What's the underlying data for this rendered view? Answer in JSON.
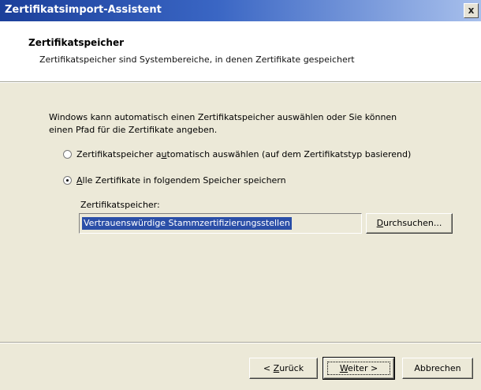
{
  "window": {
    "title": "Zertifikatsimport-Assistent",
    "close_label": "x"
  },
  "header": {
    "title": "Zertifikatspeicher",
    "subtitle": "Zertifikatspeicher sind Systembereiche, in denen Zertifikate gespeichert"
  },
  "body": {
    "intro_line1": "Windows kann automatisch einen Zertifikatspeicher auswählen oder Sie können",
    "intro_line2": "einen Pfad für die Zertifikate angeben.",
    "radio_auto": {
      "prefix": "Zertifikatspeicher a",
      "accel": "u",
      "suffix": "tomatisch auswählen  (auf dem Zertifikatstyp basierend)",
      "checked": false
    },
    "radio_manual": {
      "prefix": "",
      "accel": "A",
      "suffix": "lle Zertifikate in folgendem Speicher speichern",
      "checked": true
    },
    "store_label": "Zertifikatspeicher:",
    "store_value": "Vertrauenswürdige Stammzertifizierungsstellen",
    "browse_button": {
      "accel": "D",
      "rest": "urchsuchen..."
    }
  },
  "footer": {
    "back_button": {
      "prefix": "< ",
      "accel": "Z",
      "rest": "urück"
    },
    "next_button": {
      "accel": "W",
      "rest": "eiter >"
    },
    "cancel_button": "Abbrechen"
  }
}
